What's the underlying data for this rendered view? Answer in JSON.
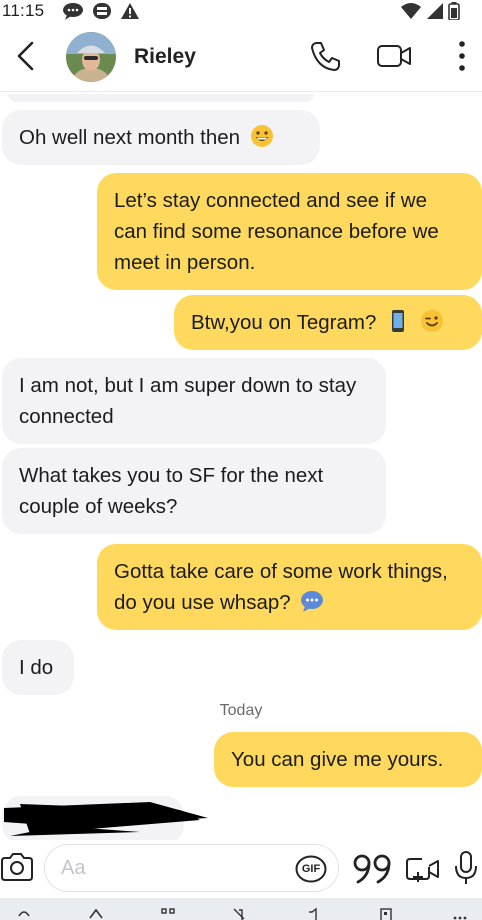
{
  "status_bar": {
    "time": "11:15"
  },
  "header": {
    "contact_name": "Rieley"
  },
  "messages": [
    {
      "direction": "in",
      "text": "Oh well next month then",
      "emoji": "grinning-face"
    },
    {
      "direction": "out",
      "text": "Let’s stay connected and see if we can find some resonance before we meet in person."
    },
    {
      "direction": "out",
      "text": "Btw,you on Tegram?",
      "emoji": "phone-and-winking-face"
    },
    {
      "direction": "in",
      "text": "I am not,  but I am super down to stay connected"
    },
    {
      "direction": "in",
      "text": "What takes you to SF for the next couple of weeks?"
    },
    {
      "direction": "out",
      "text": "Gotta take care of some work things, do you use whsap?",
      "emoji": "speech-bubble"
    },
    {
      "direction": "in",
      "text": "I do"
    },
    {
      "direction": "out",
      "text": "You can give me yours."
    }
  ],
  "day_separator": "Today",
  "composer": {
    "placeholder": "Aa",
    "gif_label": "GIF"
  },
  "colors": {
    "outgoing_bubble": "#ffd95d",
    "incoming_bubble": "#f3f2f5",
    "background": "#ffffff"
  }
}
